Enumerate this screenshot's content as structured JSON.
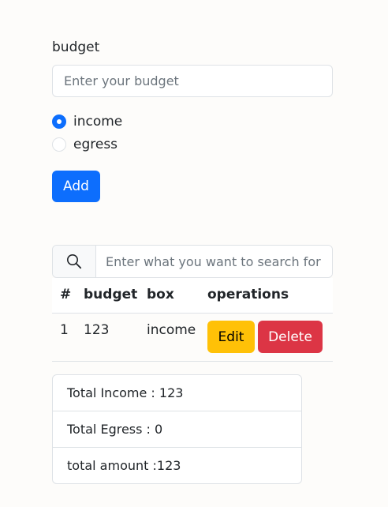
{
  "form": {
    "label": "budget",
    "placeholder": "Enter your budget",
    "radios": [
      {
        "label": "income",
        "checked": true
      },
      {
        "label": "egress",
        "checked": false
      }
    ],
    "add_label": "Add"
  },
  "search": {
    "icon": "search-icon",
    "placeholder": "Enter what you want to search for"
  },
  "table": {
    "headers": [
      "#",
      "budget",
      "box",
      "operations"
    ],
    "rows": [
      {
        "index": "1",
        "budget": "123",
        "box": "income",
        "edit_label": "Edit",
        "delete_label": "Delete"
      }
    ]
  },
  "summary": {
    "items": [
      "Total Income : 123",
      "Total Egress : 0",
      "total amount :123"
    ]
  },
  "colors": {
    "primary": "#0d6efd",
    "warning": "#ffc107",
    "danger": "#dc3545"
  }
}
